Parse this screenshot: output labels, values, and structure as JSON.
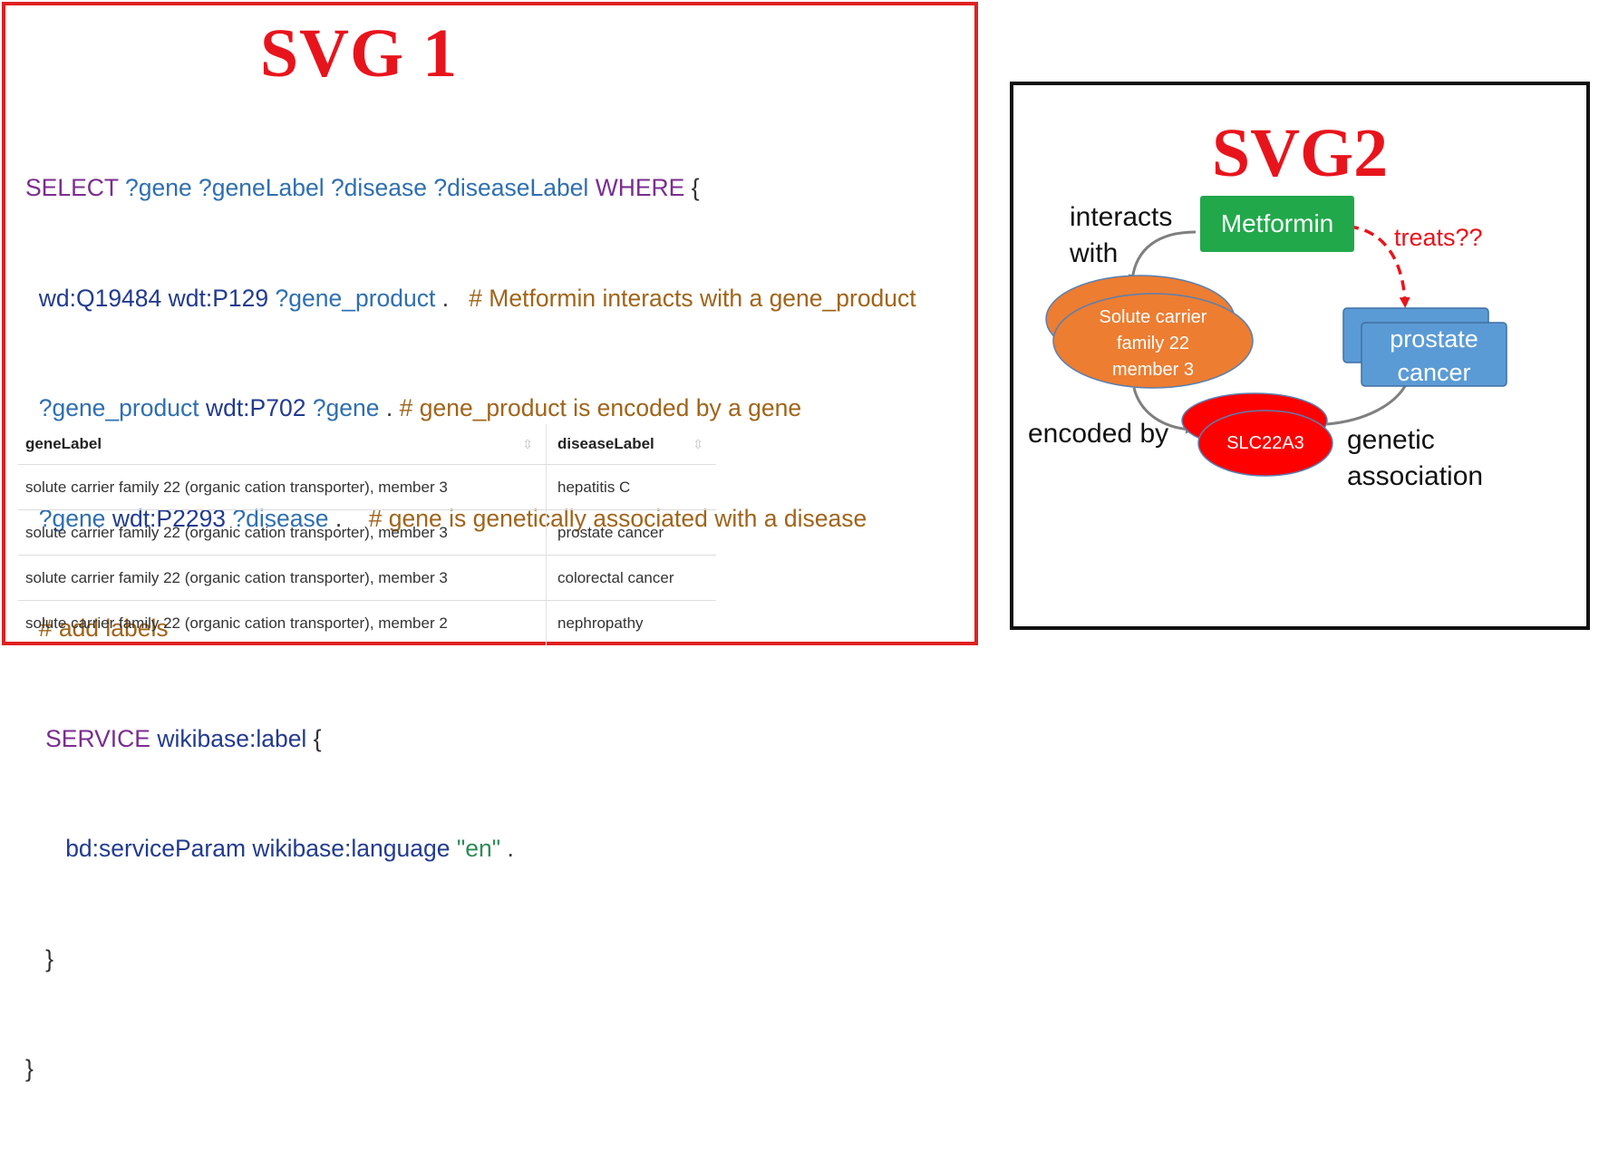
{
  "panel1": {
    "title": "SVG 1",
    "query": {
      "line1": {
        "kw1": "SELECT",
        "vars": "?gene ?geneLabel ?disease ?diseaseLabel",
        "kw2": "WHERE",
        "brace": "{"
      },
      "line2": {
        "subj": "wd:Q19484",
        "pred": "wdt:P129",
        "obj": "?gene_product",
        "dot": ".",
        "comment": "# Metformin interacts with a gene_product"
      },
      "line3": {
        "subj": "?gene_product",
        "pred": "wdt:P702",
        "obj": "?gene",
        "dot": ".",
        "comment": "# gene_product is encoded by a gene"
      },
      "line4": {
        "subj": "?gene",
        "pred": "wdt:P2293",
        "obj": "?disease",
        "dot": ".",
        "comment": "# gene is genetically associated with a disease"
      },
      "line5": {
        "comment": "# add labels"
      },
      "line6": {
        "kw": "SERVICE",
        "ent": "wikibase:label",
        "brace": "{"
      },
      "line7": {
        "param": "bd:serviceParam",
        "ent": "wikibase:language",
        "str": "\"en\"",
        "dot": "."
      },
      "line8": {
        "brace": "}"
      },
      "line9": {
        "brace": "}"
      }
    },
    "table": {
      "headers": [
        "geneLabel",
        "diseaseLabel"
      ],
      "sort_icon": "⇳",
      "rows": [
        [
          "solute carrier family 22 (organic cation transporter), member 3",
          "hepatitis C"
        ],
        [
          "solute carrier family 22 (organic cation transporter), member 3",
          "prostate cancer"
        ],
        [
          "solute carrier family 22 (organic cation transporter), member 3",
          "colorectal cancer"
        ],
        [
          "solute carrier family 22 (organic cation transporter), member 2",
          "nephropathy"
        ]
      ]
    }
  },
  "panel2": {
    "title": "SVG2",
    "nodes": {
      "metformin": "Metformin",
      "solute_line1": "Solute carrier",
      "solute_line2": "family 22",
      "solute_line3": "member 3",
      "slc": "SLC22A3",
      "prostate_line1": "prostate",
      "prostate_line2": "cancer"
    },
    "edges": {
      "interacts_line1": "interacts",
      "interacts_line2": "with",
      "encoded_by": "encoded by",
      "genetic_line1": "genetic",
      "genetic_line2": "association",
      "treats": "treats??"
    },
    "colors": {
      "metformin": "#21a84a",
      "solute": "#ed7d31",
      "slc": "#ff0000",
      "prostate": "#5b9bd5",
      "edge": "#7f7f7f",
      "treats": "#e8141c"
    }
  }
}
